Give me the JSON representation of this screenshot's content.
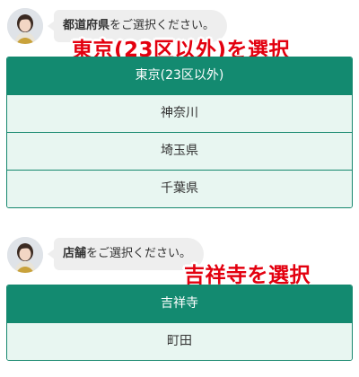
{
  "section1": {
    "prompt_bold": "都道府県",
    "prompt_rest": "をご選択ください。",
    "options": [
      "東京(23区以外)",
      "神奈川",
      "埼玉県",
      "千葉県"
    ],
    "selected_index": 0,
    "annotation": "東京(23区以外)を選択"
  },
  "section2": {
    "prompt_bold": "店舗",
    "prompt_rest": "をご選択ください。",
    "options": [
      "吉祥寺",
      "町田"
    ],
    "selected_index": 0,
    "annotation": "吉祥寺を選択"
  },
  "colors": {
    "accent": "#138a70",
    "option_bg": "#e8f6f1",
    "bubble_bg": "#eeeeee",
    "annotation": "#e3000f"
  },
  "icons": {
    "avatar": "operator-avatar-icon"
  }
}
